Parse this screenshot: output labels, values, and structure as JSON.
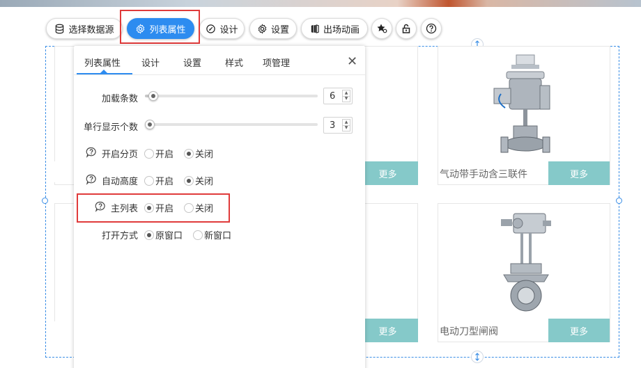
{
  "toolbar": {
    "select_datasource": "选择数据源",
    "list_props": "列表属性",
    "design": "设计",
    "settings": "设置",
    "entrance_anim": "出场动画"
  },
  "panel": {
    "tabs": [
      "列表属性",
      "设计",
      "设置",
      "样式",
      "项管理"
    ],
    "close": "✕",
    "load_count": {
      "label": "加载条数",
      "value": "6",
      "level": 0.05
    },
    "per_row": {
      "label": "单行显示个数",
      "value": "3",
      "level": 0.03
    },
    "paging": {
      "label": "开启分页",
      "on": "开启",
      "off": "关闭",
      "selected": "off"
    },
    "auto_height": {
      "label": "自动高度",
      "on": "开启",
      "off": "关闭",
      "selected": "off"
    },
    "main_list": {
      "label": "主列表",
      "on": "开启",
      "off": "关闭",
      "selected": "on"
    },
    "open_mode": {
      "label": "打开方式",
      "opt1": "原窗口",
      "opt2": "新窗口",
      "selected": "opt1"
    }
  },
  "products": [
    {
      "title": "",
      "more": "更多"
    },
    {
      "title": "气动带手动含三联件",
      "more": "更多"
    },
    {
      "title": "",
      "more": "更多"
    },
    {
      "title": "电动刀型闸阀",
      "more": "更多"
    }
  ],
  "colors": {
    "accent": "#2d8cf0",
    "more_bg": "#85c9c9",
    "highlight": "#e03a3a"
  }
}
